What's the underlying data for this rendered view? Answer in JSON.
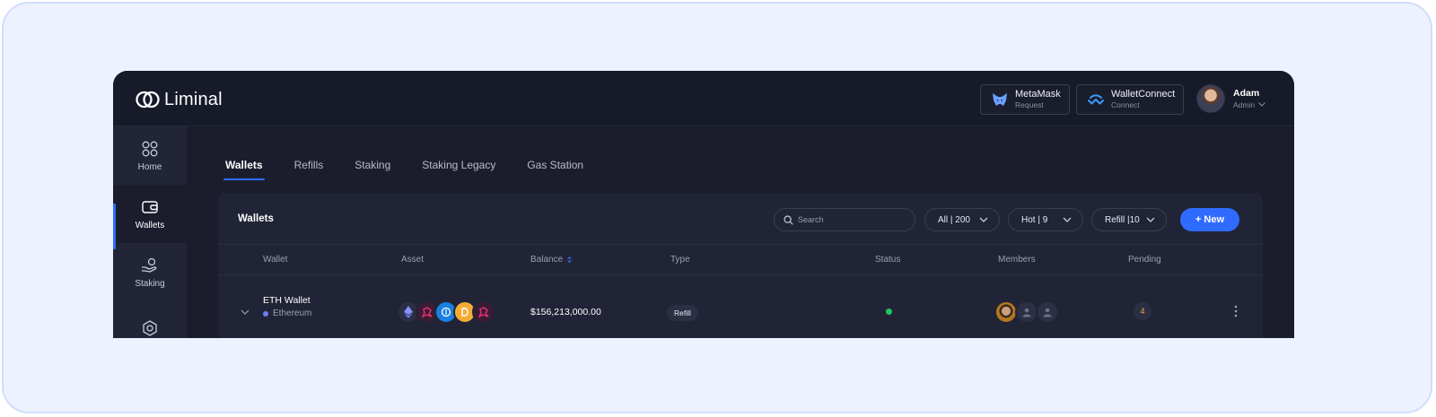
{
  "brand": {
    "name": "Liminal"
  },
  "header": {
    "metamask": {
      "title": "MetaMask",
      "subtitle": "Request"
    },
    "walletconnect": {
      "title": "WalletConnect",
      "subtitle": "Connect"
    },
    "user": {
      "name": "Adam",
      "role": "Admin"
    }
  },
  "sidebar": {
    "items": [
      {
        "label": "Home",
        "icon": "grid-circles-icon"
      },
      {
        "label": "Wallets",
        "icon": "wallet-icon",
        "active": true
      },
      {
        "label": "Staking",
        "icon": "hand-coin-icon"
      },
      {
        "label": "",
        "icon": "hexagon-icon"
      }
    ]
  },
  "tabs": [
    "Wallets",
    "Refills",
    "Staking",
    "Staking Legacy",
    "Gas Station"
  ],
  "active_tab": "Wallets",
  "panel": {
    "title": "Wallets",
    "search_placeholder": "Search",
    "filters": [
      "All | 200",
      "Hot | 9",
      "Refill |10"
    ],
    "new_button": "+ New",
    "columns": [
      "Wallet",
      "Asset",
      "Balance",
      "Type",
      "Status",
      "Members",
      "Pending"
    ],
    "rows": [
      {
        "wallet": "ETH Wallet",
        "network": "Ethereum",
        "balance": "$156,213,000.00",
        "type": "Refill",
        "status": "active",
        "pending": "4"
      }
    ]
  },
  "colors": {
    "accent": "#2f6bff",
    "background": "#1b1d2d",
    "status_active": "#22c55e",
    "pending": "#f7a531"
  }
}
